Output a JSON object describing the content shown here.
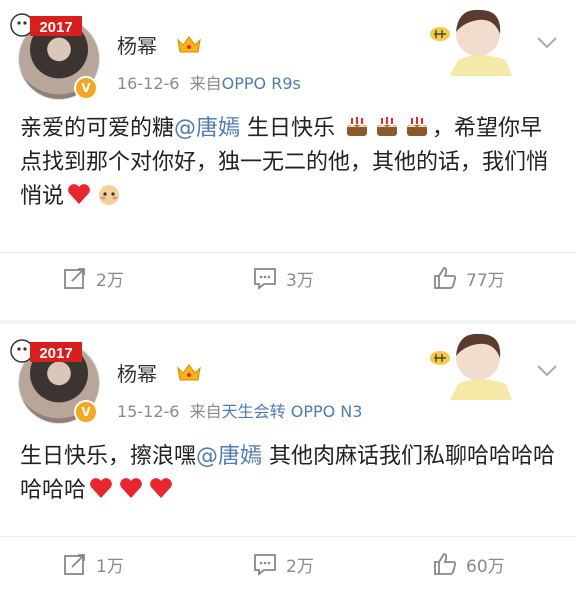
{
  "posts": [
    {
      "author": "杨幂",
      "date": "16-12-6",
      "source_prefix": "来自",
      "source": "OPPO R9s",
      "text_a": "亲爱的可爱的糖",
      "mention": "@唐嫣",
      "text_b": " 生日快乐",
      "text_c": "，希望你早点找到那个对你好，独一无二的他，其他的话，我们悄悄说",
      "repost_count": "2万",
      "comment_count": "3万",
      "like_count": "77万"
    },
    {
      "author": "杨幂",
      "date": "15-12-6",
      "source_prefix": "来自",
      "source": "天生会转 OPPO N3",
      "text_a": "生日快乐，擦浪嘿",
      "mention": "@唐嫣",
      "text_b": " 其他肉麻话我们私聊哈哈哈哈哈哈哈",
      "repost_count": "1万",
      "comment_count": "2万",
      "like_count": "60万"
    }
  ],
  "badge_text": "2017",
  "verified_mark": "V",
  "colors": {
    "link": "#507daf",
    "meta": "#8a8a8a",
    "heart": "#e8262d",
    "badge": "#f5a623"
  }
}
